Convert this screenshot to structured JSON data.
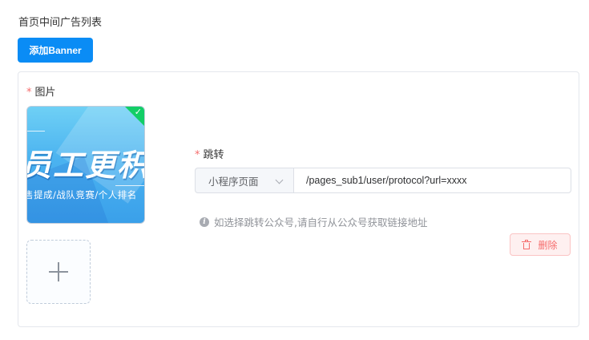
{
  "page": {
    "title": "首页中间广告列表"
  },
  "toolbar": {
    "add_label": "添加Banner"
  },
  "form": {
    "image_label": "图片",
    "image_required_mark": "*",
    "jump_label": "跳转",
    "jump_required_mark": "*",
    "jump_type_selected": "小程序页面",
    "jump_url_value": "/pages_sub1/user/protocol?url=xxxx",
    "hint_text": "如选择跳转公众号,请自行从公众号获取链接地址",
    "delete_label": "删除"
  },
  "banner_image": {
    "headline": "员工更积",
    "subline": "售提成/战队竞赛/个人排名",
    "status": "uploaded"
  },
  "icons": {
    "check": "check-icon",
    "chevron": "chevron-down-icon",
    "info": "info-icon",
    "trash": "trash-icon",
    "plus": "plus-icon"
  },
  "colors": {
    "primary": "#0a8cf5",
    "danger": "#f56c6c",
    "success": "#13ce66"
  }
}
